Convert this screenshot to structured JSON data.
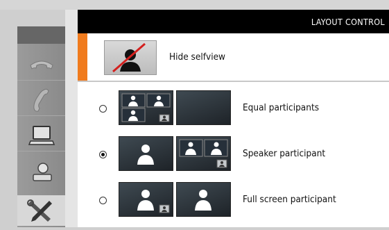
{
  "header": {
    "title": "LAYOUT CONTROL"
  },
  "selfview": {
    "label": "Hide selfview"
  },
  "options": [
    {
      "label": "Equal participants",
      "selected": false
    },
    {
      "label": "Speaker participant",
      "selected": true
    },
    {
      "label": "Full screen participant",
      "selected": false
    }
  ],
  "dock": {
    "icons": [
      "handset-icon",
      "phone-icon",
      "laptop-icon",
      "camera-icon",
      "tools-icon"
    ]
  },
  "colors": {
    "accent": "#f07b1d",
    "header_bg": "#000000"
  }
}
